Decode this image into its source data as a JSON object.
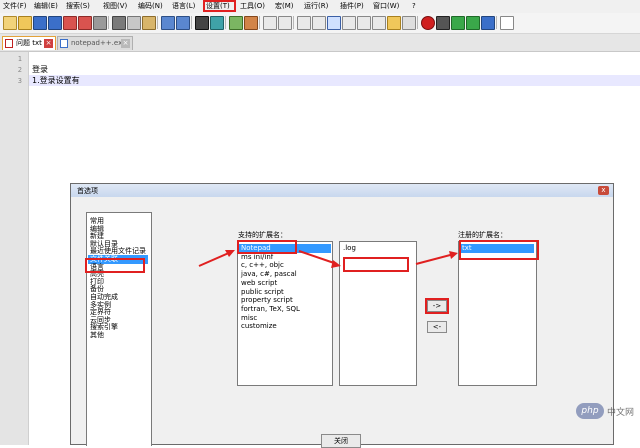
{
  "menu": [
    "文件(F)",
    "编辑(E)",
    "搜索(S)",
    "视图(V)",
    "编码(N)",
    "语言(L)",
    "设置(T)",
    "工具(O)",
    "宏(M)",
    "运行(R)",
    "插件(P)",
    "窗口(W)",
    "?"
  ],
  "tabs": [
    {
      "label": "问题 txt",
      "active": true
    },
    {
      "label": "notepad++.exe",
      "active": false
    }
  ],
  "editor": {
    "line_numbers": [
      "1",
      "2",
      "3"
    ],
    "lines": [
      "",
      "登录",
      "1.登录设置有"
    ]
  },
  "dialog": {
    "title": "首选项",
    "close_glyph": "x",
    "categories": [
      "常用",
      "编辑",
      "新建",
      "默认目录",
      "最近使用文件记录",
      "文件关联",
      "语言",
      "高亮",
      "打印",
      "备份",
      "自动完成",
      "多实例",
      "定界符",
      "云同步",
      "搜索引擎",
      "其他"
    ],
    "selected_category": "文件关联",
    "supported_label": "支持的扩展名：",
    "supported": [
      "Notepad",
      "ms ini/inf",
      "c, c++, objc",
      "java, c#, pascal",
      "web script",
      "public script",
      "property script",
      "fortran, TeX, SQL",
      "misc",
      "customize"
    ],
    "supported_selected": "Notepad",
    "extensions": [
      ".log"
    ],
    "registered_label": "注册的扩展名：",
    "registered": [
      "txt"
    ],
    "add_button": "->",
    "remove_button": "<-",
    "close_button": "关闭"
  },
  "watermark": {
    "logo": "php",
    "text": "中文网"
  },
  "colors": {
    "highlight": "#e02020",
    "selection": "#3399ff",
    "arrow": "#e02020"
  }
}
